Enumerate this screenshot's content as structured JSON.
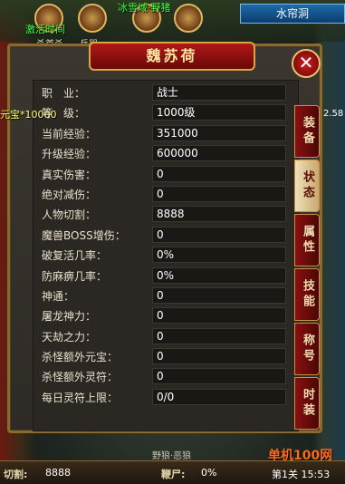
{
  "hud": {
    "top_left_green": "激活时间",
    "top_center_green": "冰雪域·野猪",
    "top_label_1": "杀首杀",
    "top_label_2": "兵器",
    "location": "水帘洞",
    "right_number": "2.58",
    "left_overlay": "元宝*10000"
  },
  "panel": {
    "title": "魏苏荷",
    "close_label": "✕"
  },
  "stats": [
    {
      "label": "职　业：",
      "value": "战士"
    },
    {
      "label": "等　级：",
      "value": "1000级"
    },
    {
      "label": "当前经验：",
      "value": "351000"
    },
    {
      "label": "升级经验：",
      "value": "600000"
    },
    {
      "label": "真实伤害：",
      "value": "0"
    },
    {
      "label": "绝对减伤：",
      "value": "0"
    },
    {
      "label": "人物切割：",
      "value": "8888"
    },
    {
      "label": "魔兽BOSS增伤：",
      "value": "0"
    },
    {
      "label": "破复活几率：",
      "value": "0%"
    },
    {
      "label": "防麻痹几率：",
      "value": "0%"
    },
    {
      "label": "神通：",
      "value": "0"
    },
    {
      "label": "屠龙神力：",
      "value": "0"
    },
    {
      "label": "天劫之力：",
      "value": "0"
    },
    {
      "label": "杀怪额外元宝：",
      "value": "0"
    },
    {
      "label": "杀怪额外灵符：",
      "value": "0"
    },
    {
      "label": "每日灵符上限：",
      "value": "0/0"
    }
  ],
  "tabs": [
    {
      "label": "装备",
      "active": false
    },
    {
      "label": "状态",
      "active": true
    },
    {
      "label": "属性",
      "active": false
    },
    {
      "label": "技能",
      "active": false
    },
    {
      "label": "称号",
      "active": false
    },
    {
      "label": "时装",
      "active": false
    }
  ],
  "bottom": {
    "cut_label": "切割:",
    "cut_value": "8888",
    "corpse_label": "鞭尸:",
    "corpse_value": "0%",
    "mid_text": "野狼·恶狼",
    "watermark": "单机100网",
    "position_text": "第1关 15:53"
  },
  "colors": {
    "panel_border": "#8a6a30",
    "title_red": "#b01818",
    "tab_red": "#8a1010",
    "hud_green": "#3cff3c"
  }
}
